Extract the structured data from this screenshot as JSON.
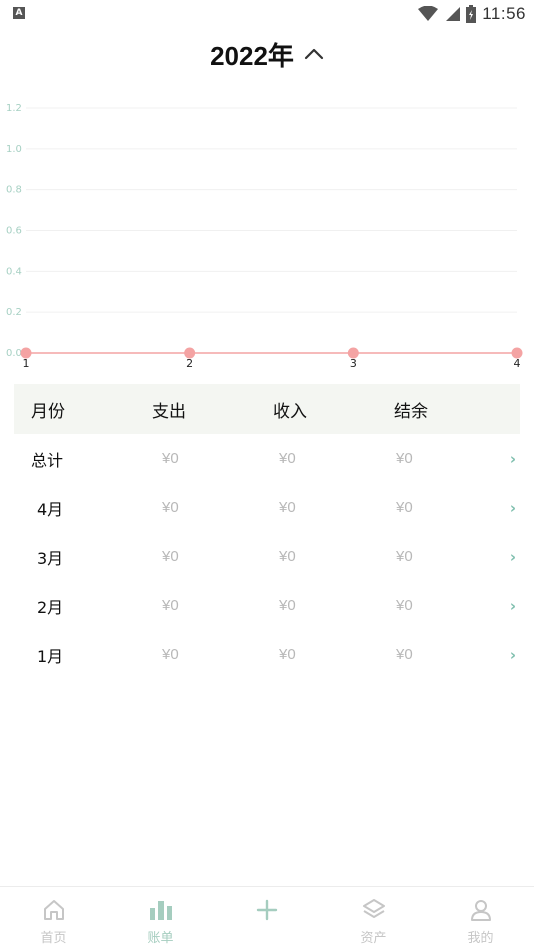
{
  "status_bar": {
    "left_icon_letter": "A",
    "time": "11:56",
    "icons": [
      "wifi-icon",
      "signal-icon",
      "battery-icon"
    ]
  },
  "header": {
    "year_title": "2022年",
    "toggle_icon": "chevron-up-icon"
  },
  "chart_data": {
    "type": "line",
    "x": [
      1,
      2,
      3,
      4
    ],
    "series": [
      {
        "values": [
          0,
          0,
          0,
          0
        ],
        "color": "#f4a3a3"
      }
    ],
    "ylim": [
      0,
      1.2
    ],
    "y_ticks": [
      "0.0",
      "0.2",
      "0.4",
      "0.6",
      "0.8",
      "1.0",
      "1.2"
    ],
    "x_ticks": [
      "1",
      "2",
      "3",
      "4"
    ],
    "grid": true,
    "tick_color": "#a6d0c3"
  },
  "table": {
    "headers": [
      "月份",
      "支出",
      "收入",
      "结余"
    ],
    "rows": [
      {
        "month": "总计",
        "expense": "¥0",
        "income": "¥0",
        "balance": "¥0"
      },
      {
        "month": "4月",
        "expense": "¥0",
        "income": "¥0",
        "balance": "¥0"
      },
      {
        "month": "3月",
        "expense": "¥0",
        "income": "¥0",
        "balance": "¥0"
      },
      {
        "month": "2月",
        "expense": "¥0",
        "income": "¥0",
        "balance": "¥0"
      },
      {
        "month": "1月",
        "expense": "¥0",
        "income": "¥0",
        "balance": "¥0"
      }
    ],
    "row_chevron": "›"
  },
  "nav": {
    "items": [
      {
        "label": "首页",
        "icon": "home-icon"
      },
      {
        "label": "账单",
        "icon": "bar-chart-icon",
        "active": true
      },
      {
        "label": "",
        "icon": "plus-icon"
      },
      {
        "label": "资产",
        "icon": "layers-icon"
      },
      {
        "label": "我的",
        "icon": "user-icon"
      }
    ],
    "active_color": "#a5cdbf",
    "inactive_color": "#c6c6c6"
  }
}
